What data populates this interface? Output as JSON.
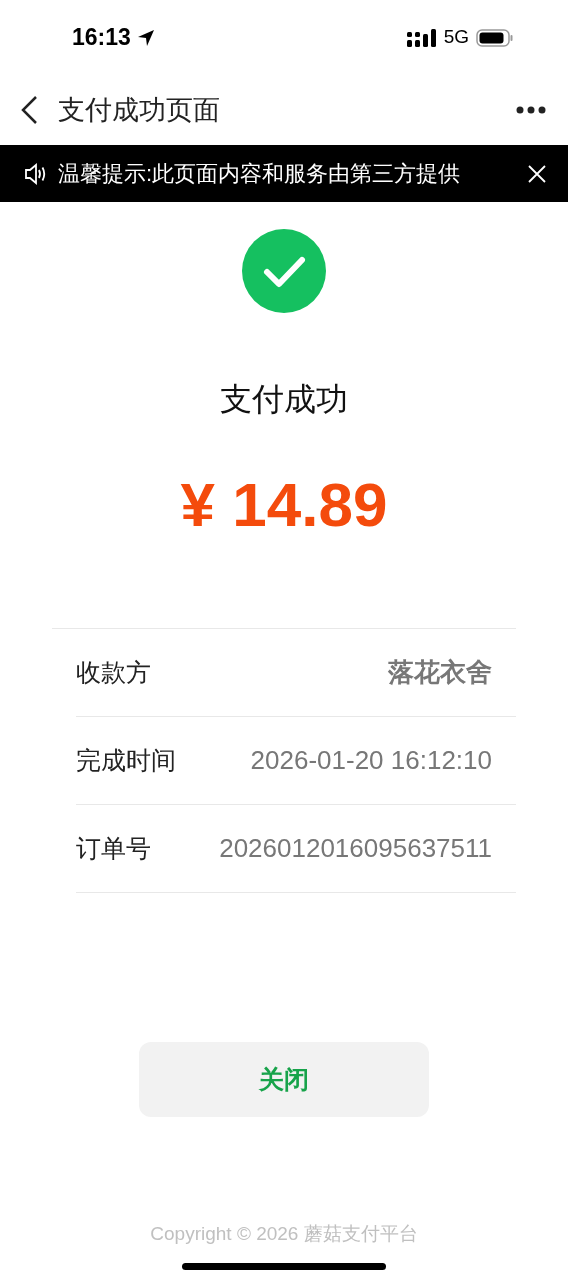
{
  "status_bar": {
    "time": "16:13",
    "network": "5G"
  },
  "nav": {
    "title": "支付成功页面"
  },
  "notice": {
    "text": "温馨提示:此页面内容和服务由第三方提供"
  },
  "result": {
    "title": "支付成功",
    "amount": "¥ 14.89"
  },
  "details": [
    {
      "label": "收款方",
      "value": "落花衣舍",
      "bold": true
    },
    {
      "label": "完成时间",
      "value": "2026-01-20 16:12:10",
      "bold": false
    },
    {
      "label": "订单号",
      "value": "2026012016095637511",
      "bold": false
    }
  ],
  "close_button": "关闭",
  "footer": "Copyright © 2026 蘑菇支付平台"
}
